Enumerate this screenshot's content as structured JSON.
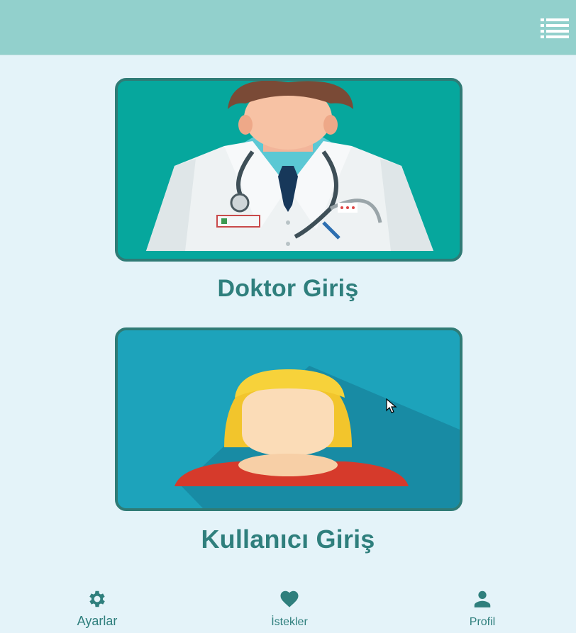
{
  "appbar": {
    "menu_icon": "list-icon",
    "color": "#92d0cc"
  },
  "cards": [
    {
      "id": "doctor",
      "title": "Doktor Giriş",
      "background": "#06a79d"
    },
    {
      "id": "user",
      "title": "Kullanıcı Giriş",
      "background": "#1da3bb"
    }
  ],
  "bottom_nav": {
    "items": [
      {
        "label": "Ayarlar",
        "icon": "gear-icon"
      },
      {
        "label": "İstekler",
        "icon": "heart-icon"
      },
      {
        "label": "Profil",
        "icon": "person-icon"
      }
    ]
  },
  "colors": {
    "background": "#e4f3f9",
    "accent": "#2f7f7d"
  }
}
